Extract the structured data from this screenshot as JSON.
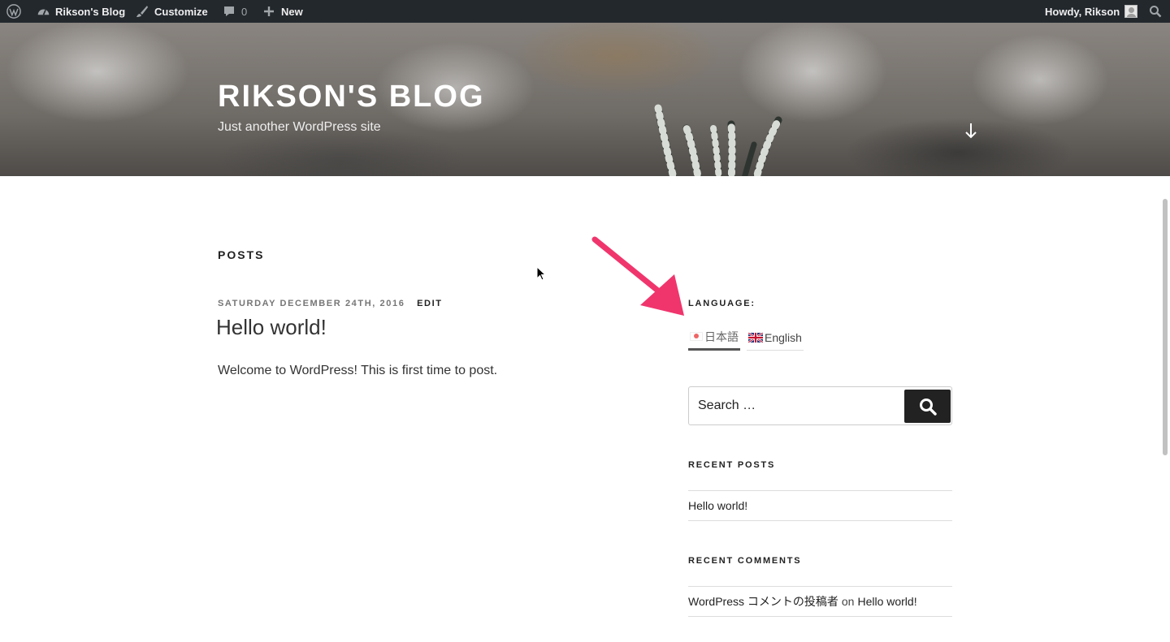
{
  "adminbar": {
    "wp_logo_icon": "wordpress-icon",
    "site_name": "Rikson's Blog",
    "customize": "Customize",
    "comments_count": "0",
    "new_label": "New",
    "howdy": "Howdy, Rikson"
  },
  "header": {
    "site_title": "RIKSON'S BLOG",
    "site_description": "Just another WordPress site"
  },
  "main": {
    "posts_heading": "POSTS",
    "post": {
      "date": "SATURDAY DECEMBER 24TH, 2016",
      "edit": "EDIT",
      "title": "Hello world!",
      "excerpt": "Welcome to WordPress! This is first time to post."
    }
  },
  "sidebar": {
    "language": {
      "title": "LANGUAGE:",
      "options": [
        {
          "label": "日本語",
          "current": true
        },
        {
          "label": "English",
          "current": false
        }
      ]
    },
    "search": {
      "placeholder": "Search …"
    },
    "recent_posts": {
      "title": "RECENT POSTS",
      "items": [
        "Hello world!"
      ]
    },
    "recent_comments": {
      "title": "RECENT COMMENTS",
      "author": "WordPress コメントの投稿者",
      "on": "on",
      "post": "Hello world!"
    }
  },
  "colors": {
    "adminbar_bg": "#23282d",
    "annotation_arrow": "#f0356d",
    "search_button": "#222222"
  }
}
